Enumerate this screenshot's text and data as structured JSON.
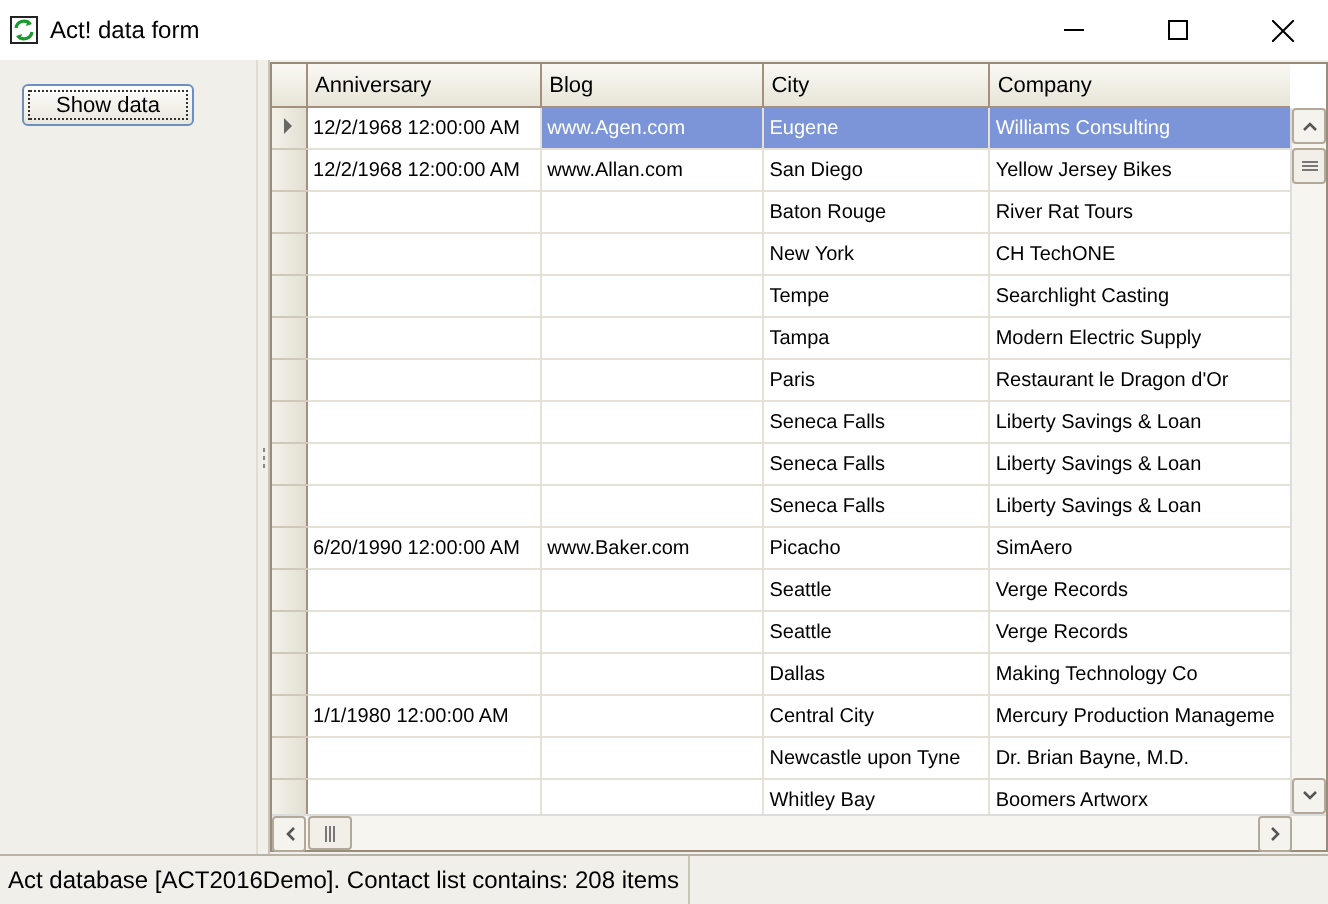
{
  "window": {
    "title": "Act! data form"
  },
  "sidebar": {
    "button": "Show data"
  },
  "table": {
    "columns": [
      "Anniversary",
      "Blog",
      "City",
      "Company"
    ],
    "rows": [
      {
        "cells": [
          "12/2/1968 12:00:00 AM",
          "www.Agen.com",
          "Eugene",
          "Williams Consulting"
        ],
        "selected": true,
        "current": true
      },
      {
        "cells": [
          "12/2/1968 12:00:00 AM",
          "www.Allan.com",
          "San Diego",
          "Yellow Jersey Bikes"
        ],
        "selected": false,
        "current": false
      },
      {
        "cells": [
          "",
          "",
          "Baton Rouge",
          "River Rat Tours"
        ],
        "selected": false,
        "current": false
      },
      {
        "cells": [
          "",
          "",
          "New York",
          "CH TechONE"
        ],
        "selected": false,
        "current": false
      },
      {
        "cells": [
          "",
          "",
          "Tempe",
          "Searchlight Casting"
        ],
        "selected": false,
        "current": false
      },
      {
        "cells": [
          "",
          "",
          "Tampa",
          "Modern Electric Supply"
        ],
        "selected": false,
        "current": false
      },
      {
        "cells": [
          "",
          "",
          "Paris",
          "Restaurant le Dragon d'Or"
        ],
        "selected": false,
        "current": false
      },
      {
        "cells": [
          "",
          "",
          "Seneca Falls",
          "Liberty Savings & Loan"
        ],
        "selected": false,
        "current": false
      },
      {
        "cells": [
          "",
          "",
          "Seneca Falls",
          "Liberty Savings & Loan"
        ],
        "selected": false,
        "current": false
      },
      {
        "cells": [
          "",
          "",
          "Seneca Falls",
          "Liberty Savings & Loan"
        ],
        "selected": false,
        "current": false
      },
      {
        "cells": [
          "6/20/1990 12:00:00 AM",
          "www.Baker.com",
          "Picacho",
          "SimAero"
        ],
        "selected": false,
        "current": false
      },
      {
        "cells": [
          "",
          "",
          "Seattle",
          "Verge Records"
        ],
        "selected": false,
        "current": false
      },
      {
        "cells": [
          "",
          "",
          "Seattle",
          "Verge Records"
        ],
        "selected": false,
        "current": false
      },
      {
        "cells": [
          "",
          "",
          "Dallas",
          "Making Technology Co"
        ],
        "selected": false,
        "current": false
      },
      {
        "cells": [
          "1/1/1980 12:00:00 AM",
          "",
          "Central City",
          "Mercury Production Manageme"
        ],
        "selected": false,
        "current": false
      },
      {
        "cells": [
          "",
          "",
          "Newcastle upon Tyne",
          "Dr. Brian Bayne, M.D."
        ],
        "selected": false,
        "current": false
      },
      {
        "cells": [
          "",
          "",
          "Whitley Bay",
          "Boomers Artworx"
        ],
        "selected": false,
        "current": false
      }
    ]
  },
  "status_bar": "Act database [ACT2016Demo]. Contact list contains: 208 items"
}
